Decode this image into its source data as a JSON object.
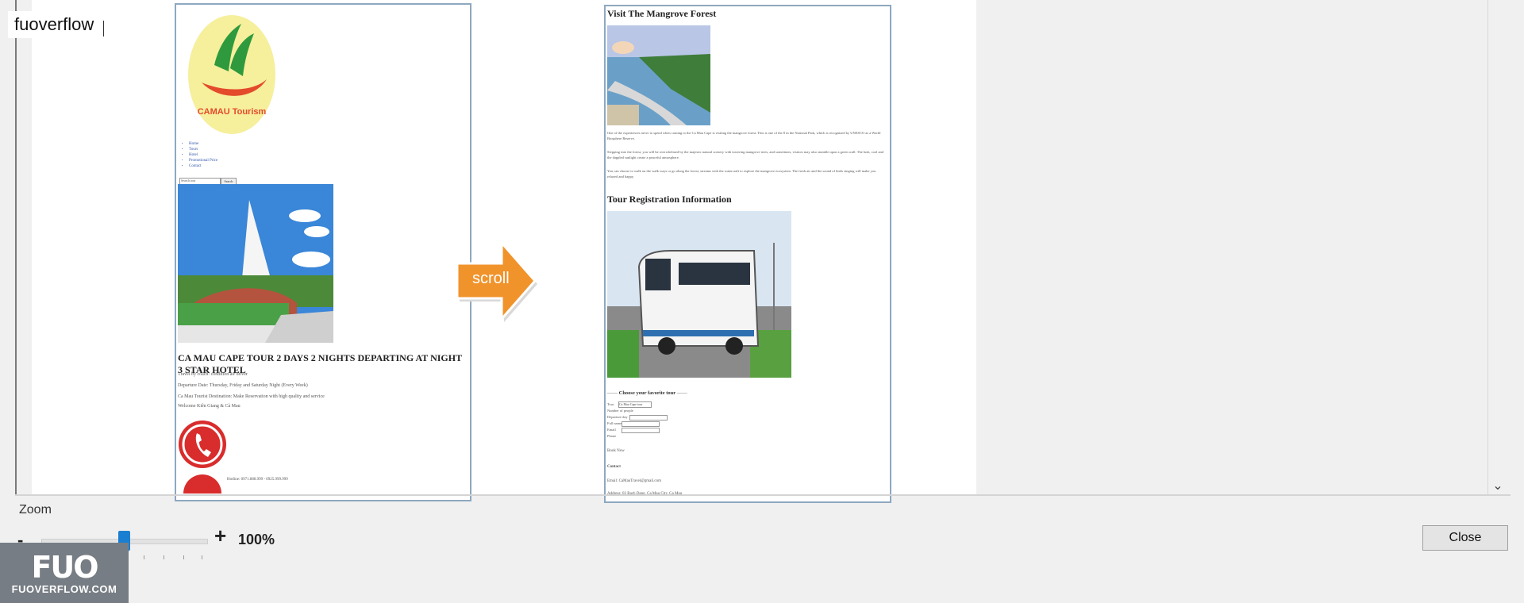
{
  "title_field": {
    "value": "fuoverflow"
  },
  "left_page": {
    "logo_text": "CAMAU Tourism",
    "nav_items": [
      "Home",
      "Tours",
      "Hotel",
      "Promotional Price",
      "Contact"
    ],
    "search_placeholder": "Search tour",
    "search_button": "Search",
    "tour_title": "CA MAU CAPE TOUR 2 DAYS 2 NIGHTS DEPARTING AT NIGHT 3 STAR HOTEL",
    "info_lines": [
      "Travel by coach: condition air driver",
      "Departure Date: Thursday, Friday and Saturday Night (Every Week)",
      "Ca Mau Tourist Destination: Make Reservation with high quality and service",
      "Welcome Kiên Giang & Cà Mau"
    ],
    "hotline": "Hotline: 0971.888.999 - 0925.999.999"
  },
  "scroll_label": "scroll",
  "right_page": {
    "heading1": "Visit The Mangrove Forest",
    "paragraphs": [
      "One of the experiences never to spend when coming to the Ca Mau Cape is visiting the mangrove forest. This is one of the 8 in the National Park, which is recognized by UNESCO as a World Biosphere Reserve.",
      "Stepping into the forest, you will be overwhelmed by the majestic natural scenery with towering mangrove trees, and sometimes, visitors may also stumble upon a green wall. The lush, cool and the dappled sunlight create a peaceful atmosphere.",
      "You can choose to walk on the walk ways or go along the forest, streams with the watercraft to explore the mangrove ecosystem. The fresh air and the sound of birds singing will make you relaxed and happy."
    ],
    "heading2": "Tour Registration Information",
    "form_heading": "Choose your favorite tour",
    "form_labels": [
      "Tour",
      "Number of people",
      "Departure day",
      "Full name",
      "Email",
      "Phone"
    ],
    "tour_select": "Ca Mau Cape tour",
    "book_label": "Book Now",
    "contact_heading": "Contact",
    "email_line": "Email: CaMauTravel@gmail.com",
    "address_line": "Address: 03 Bach Dang, Ca Mau City, Ca Mau"
  },
  "controls": {
    "zoom_label": "Zoom",
    "minus": "-",
    "plus": "+",
    "zoom_value": "100%",
    "zoom_level": 0.25,
    "close_label": "Close"
  },
  "watermark": {
    "logo": "FUO",
    "text": "FUOVERFLOW.COM"
  },
  "scroll_down_icon": "chevron-down-icon",
  "colors": {
    "accent": "#1b7fd1",
    "arrow": "#f0932b",
    "logo_green": "#3aa345",
    "logo_red": "#e34b2b"
  }
}
